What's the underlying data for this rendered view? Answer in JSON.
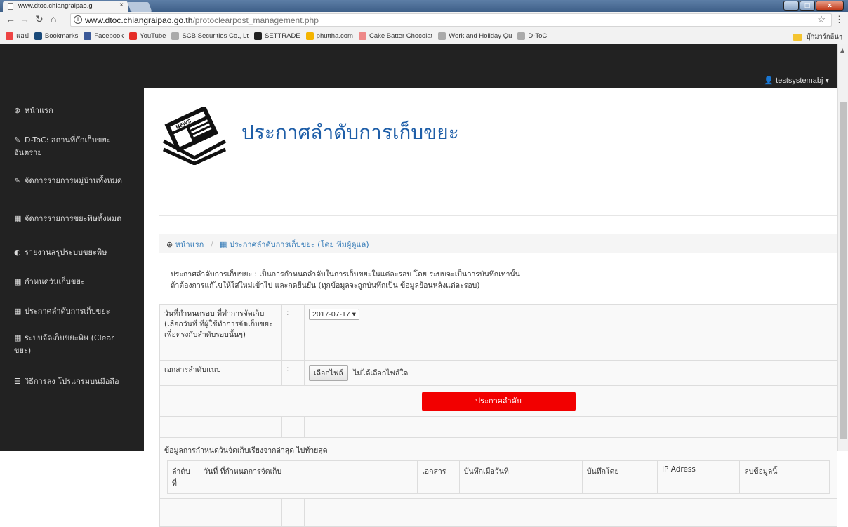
{
  "browser": {
    "tab_title": "www.dtoc.chiangraipao.g",
    "tab_close": "×",
    "url_host": "www.dtoc.chiangraipao.go.th",
    "url_path": "/protoclearpost_management.php",
    "win_min": "_",
    "win_max": "□",
    "win_close": "x"
  },
  "bookmarks": [
    {
      "label": "แอป",
      "icon": "apps-icon",
      "color": "#e44"
    },
    {
      "label": "Bookmarks",
      "icon": "star-icon",
      "color": "#1a4a7a"
    },
    {
      "label": "Facebook",
      "icon": "facebook-icon",
      "color": "#3b5998"
    },
    {
      "label": "YouTube",
      "icon": "youtube-icon",
      "color": "#e52d27"
    },
    {
      "label": "SCB Securities Co., Lt",
      "icon": "page-icon",
      "color": "#aaa"
    },
    {
      "label": "SETTRADE",
      "icon": "settrade-icon",
      "color": "#222"
    },
    {
      "label": "phuttha.com",
      "icon": "phuttha-icon",
      "color": "#f4b400"
    },
    {
      "label": "Cake Batter Chocolat",
      "icon": "cake-icon",
      "color": "#e88"
    },
    {
      "label": "Work and Holiday Qu",
      "icon": "page-icon",
      "color": "#aaa"
    },
    {
      "label": "D-ToC",
      "icon": "page-icon",
      "color": "#aaa"
    }
  ],
  "bookmarks_other": "บุ๊กมาร์กอื่นๆ",
  "user": "testsystemabj",
  "sidebar": [
    {
      "label": "หน้าแรก",
      "icon": "dashboard-icon",
      "glyph": "⊛"
    },
    {
      "label": "D-ToC: สถานที่กักเก็บขยะอันตราย",
      "icon": "wrench-icon",
      "glyph": "✎"
    },
    {
      "label": "จัดการรายการหมู่บ้านทั้งหมด",
      "icon": "wrench-icon",
      "glyph": "✎"
    },
    {
      "label": "จัดการรายการขยะพิษทั้งหมด",
      "icon": "calendar-icon",
      "glyph": "▦"
    },
    {
      "label": "รายงานสรุประบบขยะพิษ",
      "icon": "gauge-icon",
      "glyph": "◐"
    },
    {
      "label": "กำหนดวันเก็บขยะ",
      "icon": "calendar-icon",
      "glyph": "▦"
    },
    {
      "label": "ประกาศลำดับการเก็บขยะ",
      "icon": "calendar-icon",
      "glyph": "▦"
    },
    {
      "label": "ระบบจัดเก็บขยะพิษ (Clear ขยะ)",
      "icon": "calendar-icon",
      "glyph": "▦"
    },
    {
      "label": "วิธีการลง โปรแกรมบนมือถือ",
      "icon": "tasks-icon",
      "glyph": "☰"
    }
  ],
  "page_title": "ประกาศลำดับการเก็บขยะ",
  "breadcrumb": {
    "home": "หน้าแรก",
    "separator": "/",
    "current": "ประกาศลำดับการเก็บขยะ (โดย ทีมผู้ดูแล)"
  },
  "description": {
    "line1": "ประกาศลำดับการเก็บขยะ : เป็นการกำหนดลำดับในการเก็บขยะในแต่ละรอบ โดย ระบบจะเป็นการบันทึกเท่านั้น",
    "line2": "ถ้าต้องการแก้ไขให้ใส่ใหม่เข้าไป และกดยืนยัน (ทุกข้อมูลจะถูกบันทึกเป็น ข้อมูลย้อนหลังแต่ละรอบ)"
  },
  "form": {
    "colon": ":",
    "date_label": "วันที่กำหนดรอบ ที่ทำการจัดเก็บ (เลือกวันที่ ที่ผู้ใช้ทำการจัดเก็บขยะเพื่อตรงกับลำดับรอบนั้นๆ)",
    "date_value": "2017-07-17",
    "attach_label": "เอกสารลำดับแนบ",
    "file_button": "เลือกไฟล์",
    "file_status": "ไม่ได้เลือกไฟล์ใด",
    "submit": "ประกาศลำดับ",
    "history_title": "ข้อมูลการกำหนดวันจัดเก็บเรียงจากล่าสุด ไปท้ายสุด"
  },
  "history_headers": [
    "ลำดับที่",
    "วันที่ ที่กำหนดการจัดเก็บ",
    "เอกสาร",
    "บันทึกเมื่อวันที่",
    "บันทึกโดย",
    "IP Adress",
    "ลบข้อมูลนี้"
  ]
}
